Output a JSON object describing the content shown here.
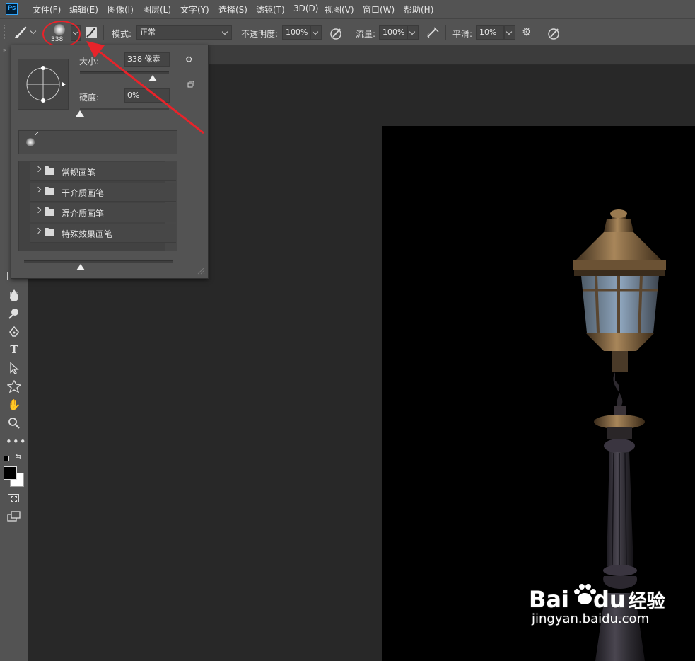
{
  "menubar": {
    "logo": "Ps",
    "items": [
      "文件(F)",
      "编辑(E)",
      "图像(I)",
      "图层(L)",
      "文字(Y)",
      "选择(S)",
      "滤镜(T)",
      "3D(D)",
      "视图(V)",
      "窗口(W)",
      "帮助(H)"
    ]
  },
  "options": {
    "brush_size": "338",
    "mode_label": "模式:",
    "mode_value": "正常",
    "opacity_label": "不透明度:",
    "opacity_value": "100%",
    "flow_label": "流量:",
    "flow_value": "100%",
    "smooth_label": "平滑:",
    "smooth_value": "10%"
  },
  "brush_popup": {
    "size_label": "大小:",
    "size_value": "338 像素",
    "size_fraction": 0.82,
    "hardness_label": "硬度:",
    "hardness_value": "0%",
    "hardness_fraction": 0.0,
    "folders": [
      "常规画笔",
      "干介质画笔",
      "湿介质画笔",
      "特殊效果画笔"
    ],
    "preview_zoom_fraction": 0.38
  },
  "colors": {
    "annotation": "#e8232a",
    "foreground": "#000000",
    "background": "#ffffff"
  },
  "watermark": {
    "brand": "Bai",
    "brand2": "du",
    "cn": "经验",
    "url": "jingyan.baidu.com"
  }
}
